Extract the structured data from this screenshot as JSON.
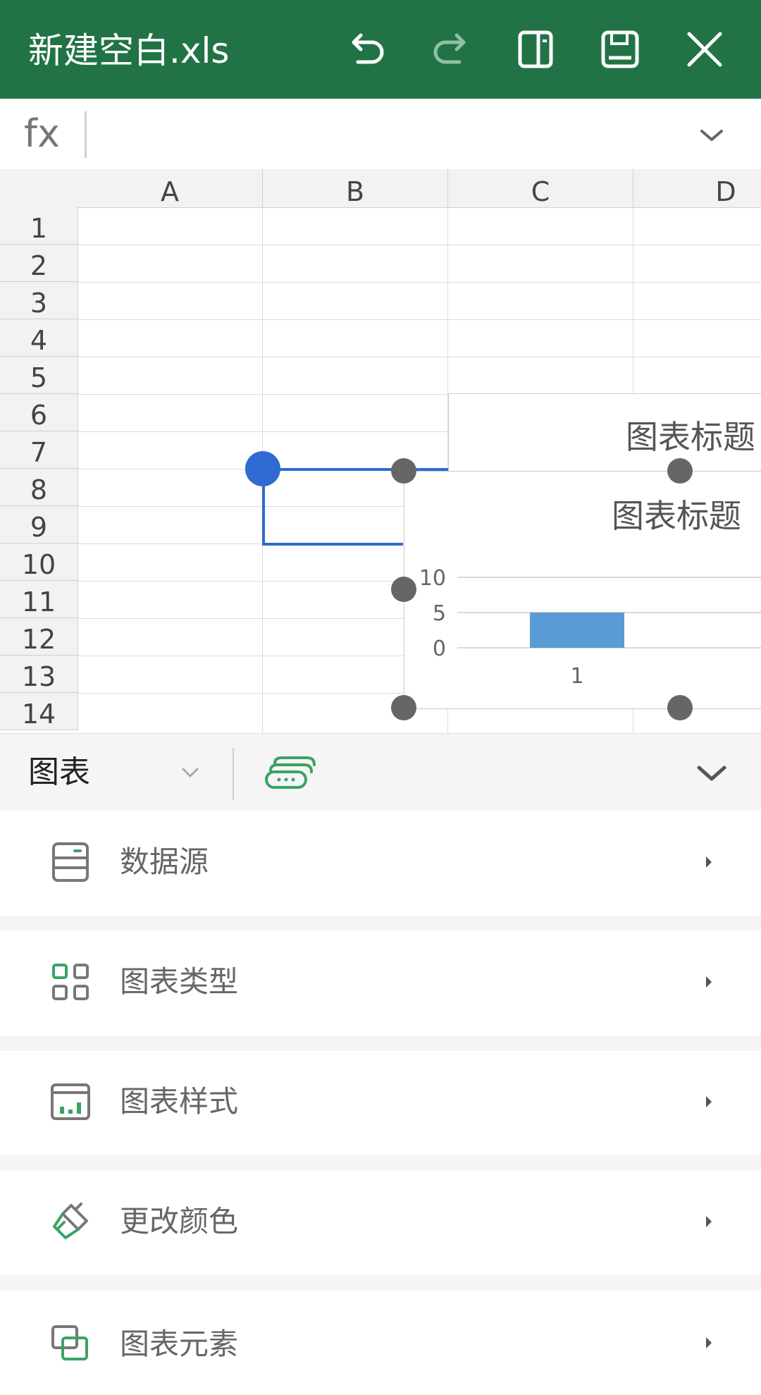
{
  "titlebar": {
    "title": "新建空白.xls",
    "icons": [
      "undo-icon",
      "redo-icon",
      "reading-mode-icon",
      "save-icon",
      "close-icon"
    ],
    "colors": {
      "background": "#217346",
      "foreground": "#ffffff",
      "disabled": "#8fbfa3"
    }
  },
  "formula_bar": {
    "label": "fx",
    "value": "",
    "expand_icon": "chevron-down-icon"
  },
  "sheet": {
    "columns": [
      "A",
      "B",
      "C",
      "D"
    ],
    "rows": [
      "1",
      "2",
      "3",
      "4",
      "5",
      "6",
      "7",
      "8",
      "9",
      "10",
      "11",
      "12",
      "13",
      "14"
    ],
    "selection_color": "#2f6bd0"
  },
  "charts": {
    "back_title": "图表标题",
    "front_title": "图表标题"
  },
  "chart_data": {
    "type": "bar",
    "title": "图表标题",
    "categories": [
      "1"
    ],
    "values": [
      5
    ],
    "ylim": [
      0,
      10
    ],
    "yticks": [
      "10",
      "5",
      "0"
    ],
    "xticks": [
      "1"
    ],
    "grid": true,
    "bar_color": "#5b9bd5"
  },
  "panel": {
    "tab_label": "图表",
    "tool_icon": "keyboard-toggle-icon",
    "collapse_icon": "chevron-down-icon",
    "accent": "#3aa364",
    "items": [
      {
        "label": "数据源",
        "icon": "data-source-icon"
      },
      {
        "label": "图表类型",
        "icon": "grid-icon"
      },
      {
        "label": "图表样式",
        "icon": "chart-style-icon"
      },
      {
        "label": "更改颜色",
        "icon": "paint-brush-icon"
      },
      {
        "label": "图表元素",
        "icon": "chart-elements-icon"
      }
    ]
  }
}
